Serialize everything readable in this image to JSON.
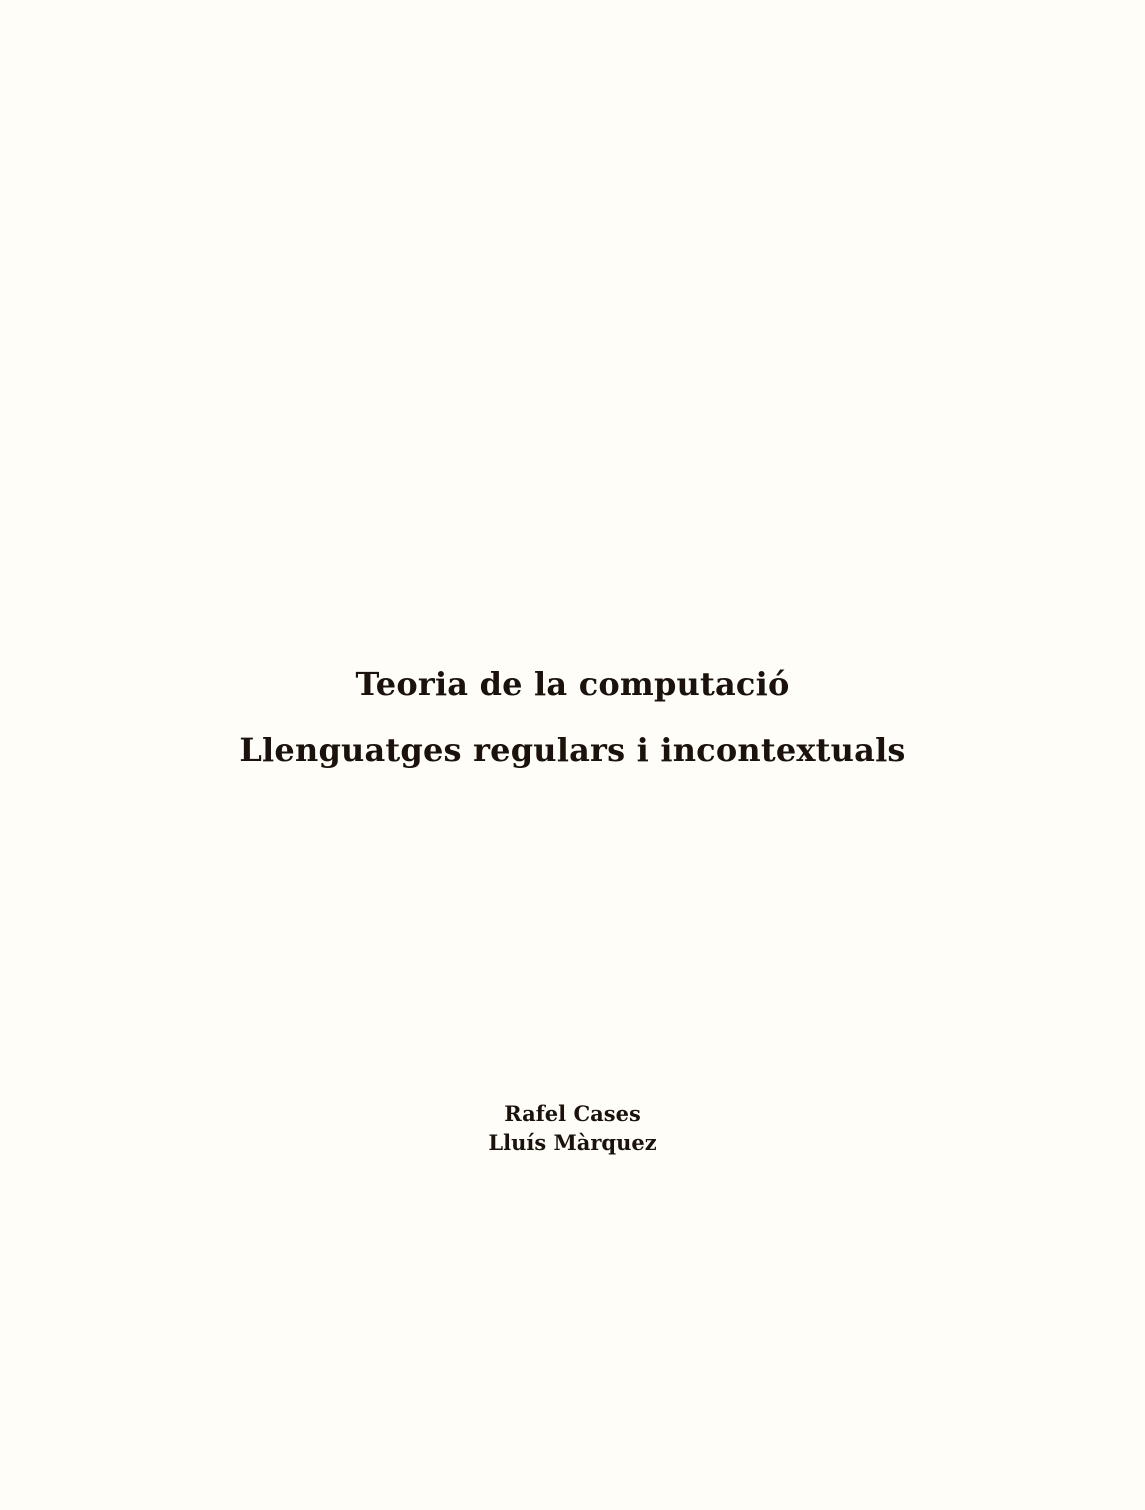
{
  "document": {
    "title": "Teoria de la computació",
    "subtitle": "Llenguatges regulars i incontextuals",
    "authors": [
      "Rafel Cases",
      "Lluís Màrquez"
    ]
  },
  "colors": {
    "background": "#fffdf8",
    "text": "#1a120b"
  }
}
